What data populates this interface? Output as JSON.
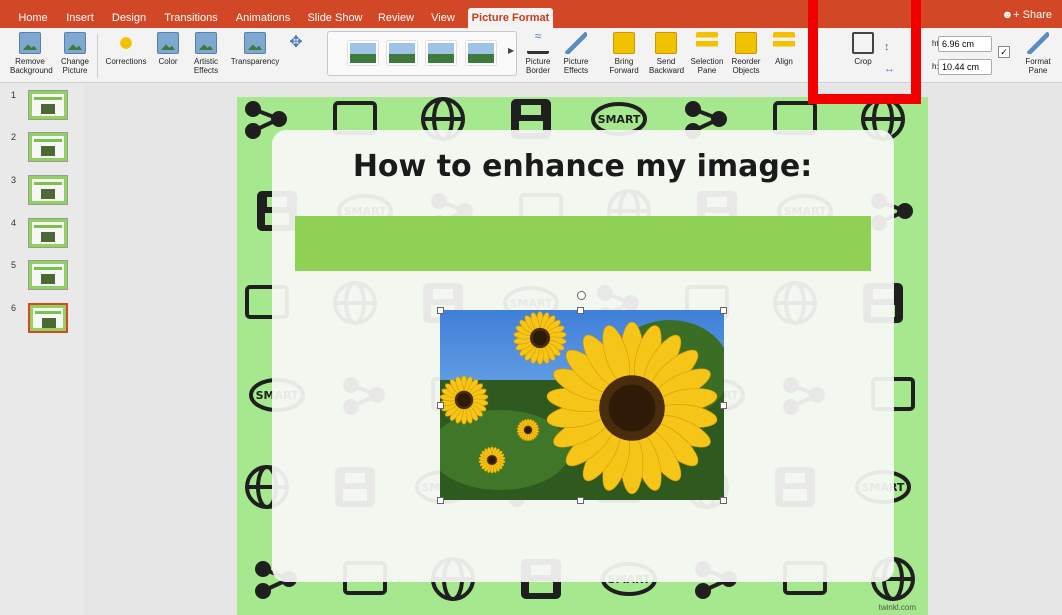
{
  "tabs": [
    "Home",
    "Insert",
    "Design",
    "Transitions",
    "Animations",
    "Slide Show",
    "Review",
    "View",
    "Picture Format"
  ],
  "active_tab": "Picture Format",
  "share_label": "Share",
  "ribbon": {
    "remove_background": "Remove Background",
    "change_picture": "Change Picture",
    "corrections": "Corrections",
    "color": "Color",
    "artistic_effects": "Artistic Effects",
    "transparency": "Transparency",
    "picture_border": "Picture Border",
    "picture_effects": "Picture Effects",
    "bring_forward": "Bring Forward",
    "send_backward": "Send Backward",
    "selection_pane": "Selection Pane",
    "reorder_objects": "Reorder Objects",
    "align": "Align",
    "crop": "Crop",
    "height_label": "ht:",
    "height_value": "6.96 cm",
    "width_label": "h:",
    "width_value": "10.44 cm",
    "format_pane": "Format Pane"
  },
  "slides": [
    {
      "number": "1"
    },
    {
      "number": "2"
    },
    {
      "number": "3"
    },
    {
      "number": "4"
    },
    {
      "number": "5"
    },
    {
      "number": "6"
    }
  ],
  "selected_slide": "6",
  "slide": {
    "title": "How to enhance my image:",
    "watermark": "twinkl.com",
    "pattern_word": "SMART"
  },
  "colors": {
    "accent": "#d24726",
    "slide_border": "#a6e88d",
    "green_box": "#8fd154",
    "highlight": "#f20000"
  }
}
